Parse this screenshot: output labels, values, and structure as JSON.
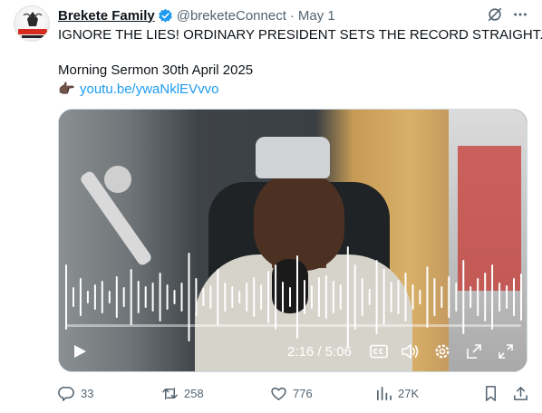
{
  "author": {
    "display_name": "Brekete Family",
    "handle": "@breketeConnect",
    "separator": "·",
    "date": "May 1",
    "verified": true,
    "avatar_icon": "brekete-family-logo"
  },
  "header_icons": {
    "grok": "grok-icon",
    "more": "more-icon"
  },
  "body": {
    "line1": "IGNORE THE LIES! ORDINARY PRESIDENT SETS THE RECORD STRAIGHT.",
    "line2": "Morning Sermon 30th April 2025",
    "emoji": "👉🏿",
    "link": "youtu.be/ywaNklEVvvo"
  },
  "video": {
    "current_time": "2:16",
    "duration": "5:06",
    "time_display": "2:16 / 5:06",
    "progress_fraction": 0.0,
    "icons": [
      "play-icon",
      "captions-icon",
      "volume-icon",
      "settings-icon",
      "expand-icon",
      "fullscreen-icon"
    ]
  },
  "actions": {
    "replies": "33",
    "reposts": "258",
    "likes": "776",
    "views": "27K"
  },
  "colors": {
    "link": "#1d9bf0",
    "secondary_text": "#536471",
    "verified_badge": "#1d9bf0",
    "primary_text": "#0f1419"
  }
}
